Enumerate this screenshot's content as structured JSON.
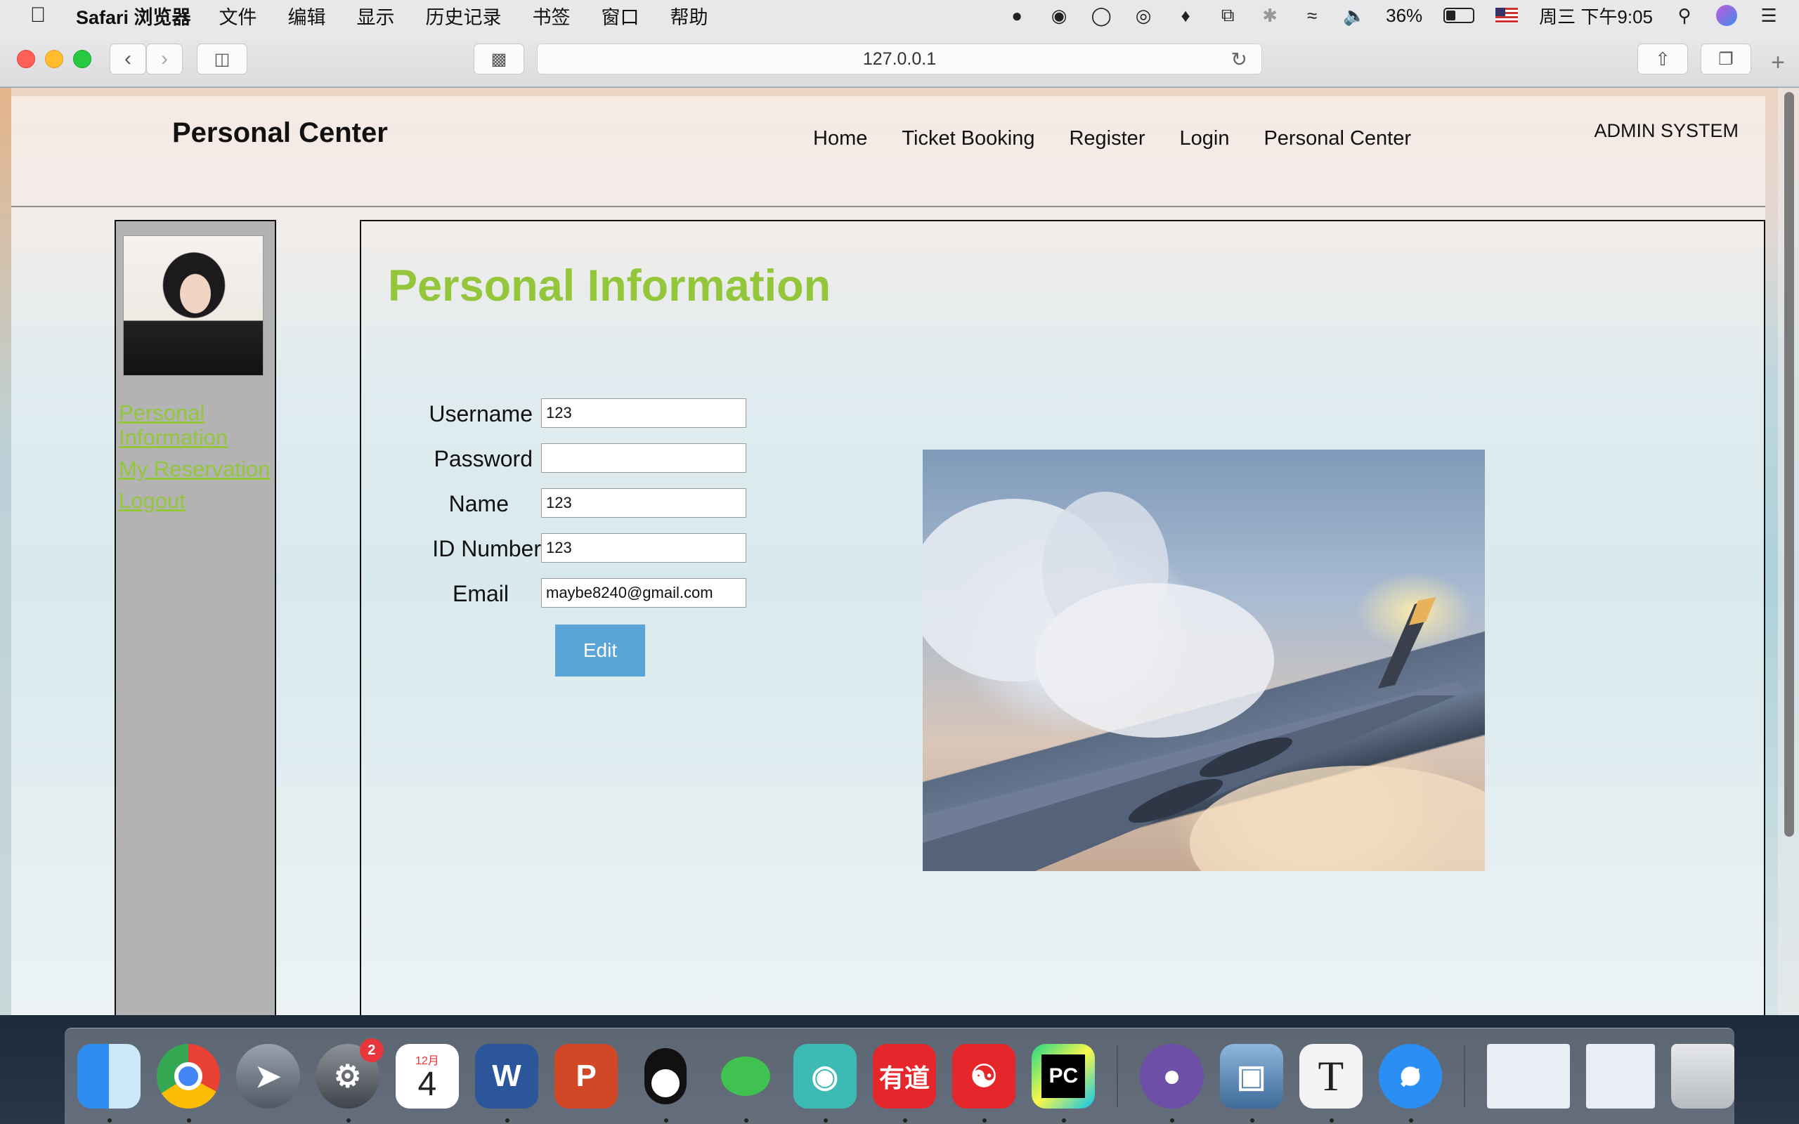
{
  "menubar": {
    "app_name": "Safari 浏览器",
    "menus": [
      "文件",
      "编辑",
      "显示",
      "历史记录",
      "书签",
      "窗口",
      "帮助"
    ],
    "battery_percent": "36%",
    "clock": "周三 下午9:05"
  },
  "browser": {
    "url": "127.0.0.1"
  },
  "site": {
    "brand": "Personal Center",
    "nav": [
      "Home",
      "Ticket Booking",
      "Register",
      "Login",
      "Personal Center"
    ],
    "admin_link": "ADMIN SYSTEM"
  },
  "sidebar": {
    "links": [
      "Personal Information",
      "My Reservation",
      "Logout"
    ]
  },
  "main": {
    "title": "Personal Information",
    "fields": [
      {
        "label": "Username",
        "value": "123"
      },
      {
        "label": "Password",
        "value": ""
      },
      {
        "label": "Name",
        "value": "123"
      },
      {
        "label": "ID Number",
        "value": "123"
      },
      {
        "label": "Email",
        "value": "maybe8240@gmail.com"
      }
    ],
    "edit_button": "Edit"
  },
  "dock": {
    "calendar_month": "12月",
    "calendar_day": "4",
    "sysprefs_badge": "2",
    "word_letter": "W",
    "ppt_letter": "P",
    "youdao_text": "有道",
    "pycharm_text": "PC",
    "typora_letter": "T"
  },
  "colors": {
    "accent_green": "#94c63c",
    "edit_button_blue": "#5ba5d6",
    "sidebar_gray": "#b3b3b3"
  }
}
